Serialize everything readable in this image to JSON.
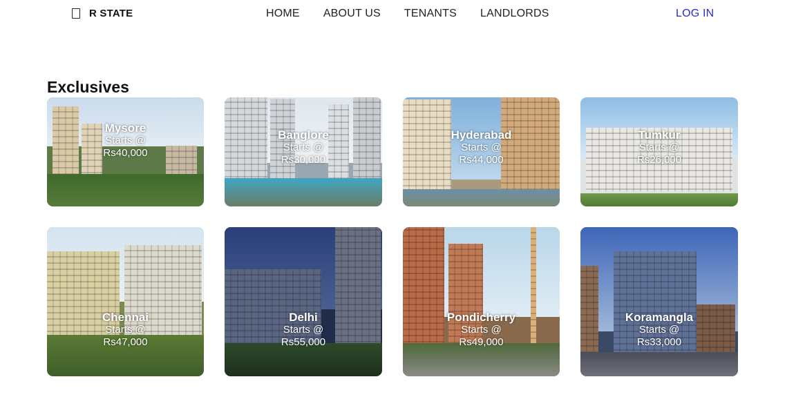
{
  "nav": {
    "brand_icon": "building-icon",
    "brand": "R STATE",
    "links": [
      "HOME",
      "ABOUT US",
      "TENANTS",
      "LANDLORDS"
    ],
    "login": "LOG IN",
    "login_color": "#2b2bd6"
  },
  "exclusives": {
    "title": "Exclusives",
    "cards": [
      {
        "city": "Mysore",
        "starts": "Starts @",
        "price": "Rs40,000"
      },
      {
        "city": "Banglore",
        "starts": "Starts @",
        "price": "Rs30,000"
      },
      {
        "city": "Hyderabad",
        "starts": "Starts @",
        "price": "Rs44,000"
      },
      {
        "city": "Tumkur",
        "starts": "Starts @",
        "price": "Rs26,000"
      },
      {
        "city": "Chennai",
        "starts": "Starts @",
        "price": "Rs47,000"
      },
      {
        "city": "Delhi",
        "starts": "Starts @",
        "price": "Rs55,000"
      },
      {
        "city": "Pondicherry",
        "starts": "Starts @",
        "price": "Rs49,000"
      },
      {
        "city": "Koramangla",
        "starts": "Starts @",
        "price": "Rs33,000"
      }
    ]
  }
}
